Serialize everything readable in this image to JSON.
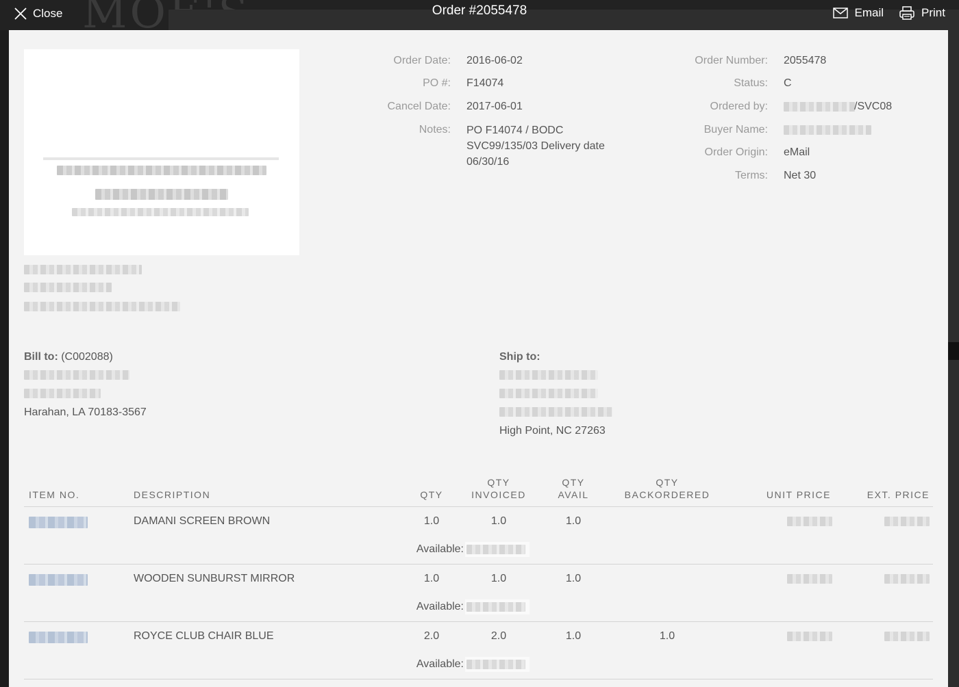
{
  "topbar": {
    "close_label": "Close",
    "title": "Order #2055478",
    "email_label": "Email",
    "print_label": "Print"
  },
  "order_meta": {
    "left": [
      {
        "label": "Order Date:",
        "value": "2016-06-02"
      },
      {
        "label": "PO #:",
        "value": "F14074"
      },
      {
        "label": "Cancel Date:",
        "value": "2017-06-01"
      },
      {
        "label": "Notes:",
        "value": "PO F14074 / BODC SVC99/135/03 Delivery date 06/30/16"
      }
    ],
    "right": [
      {
        "label": "Order Number:",
        "value": "2055478"
      },
      {
        "label": "Status:",
        "value": "C"
      },
      {
        "label": "Ordered by:",
        "value": "/SVC08"
      },
      {
        "label": "Buyer Name:",
        "value": ""
      },
      {
        "label": "Order Origin:",
        "value": "eMail"
      },
      {
        "label": "Terms:",
        "value": "Net 30"
      }
    ]
  },
  "bill_to": {
    "title": "Bill to:",
    "customer_id": "(C002088)",
    "city_line": "Harahan, LA 70183-3567"
  },
  "ship_to": {
    "title": "Ship to:",
    "city_line": "High Point, NC 27263"
  },
  "items_table": {
    "headers": {
      "item_no": "ITEM NO.",
      "description": "DESCRIPTION",
      "qty": "QTY",
      "qty_invoiced_1": "QTY",
      "qty_invoiced_2": "INVOICED",
      "qty_avail_1": "QTY",
      "qty_avail_2": "AVAIL",
      "qty_backordered_1": "QTY",
      "qty_backordered_2": "BACKORDERED",
      "unit_price": "UNIT PRICE",
      "ext_price": "EXT. PRICE"
    },
    "available_label": "Available:",
    "rows": [
      {
        "description": "DAMANI SCREEN BROWN",
        "qty": "1.0",
        "qty_invoiced": "1.0",
        "qty_avail": "1.0",
        "qty_backordered": ""
      },
      {
        "description": "WOODEN SUNBURST MIRROR",
        "qty": "1.0",
        "qty_invoiced": "1.0",
        "qty_avail": "1.0",
        "qty_backordered": ""
      },
      {
        "description": "ROYCE CLUB CHAIR BLUE",
        "qty": "2.0",
        "qty_invoiced": "2.0",
        "qty_avail": "1.0",
        "qty_backordered": "1.0"
      }
    ]
  },
  "icons": {
    "close": "close-icon",
    "email": "envelope-icon",
    "print": "printer-icon"
  }
}
